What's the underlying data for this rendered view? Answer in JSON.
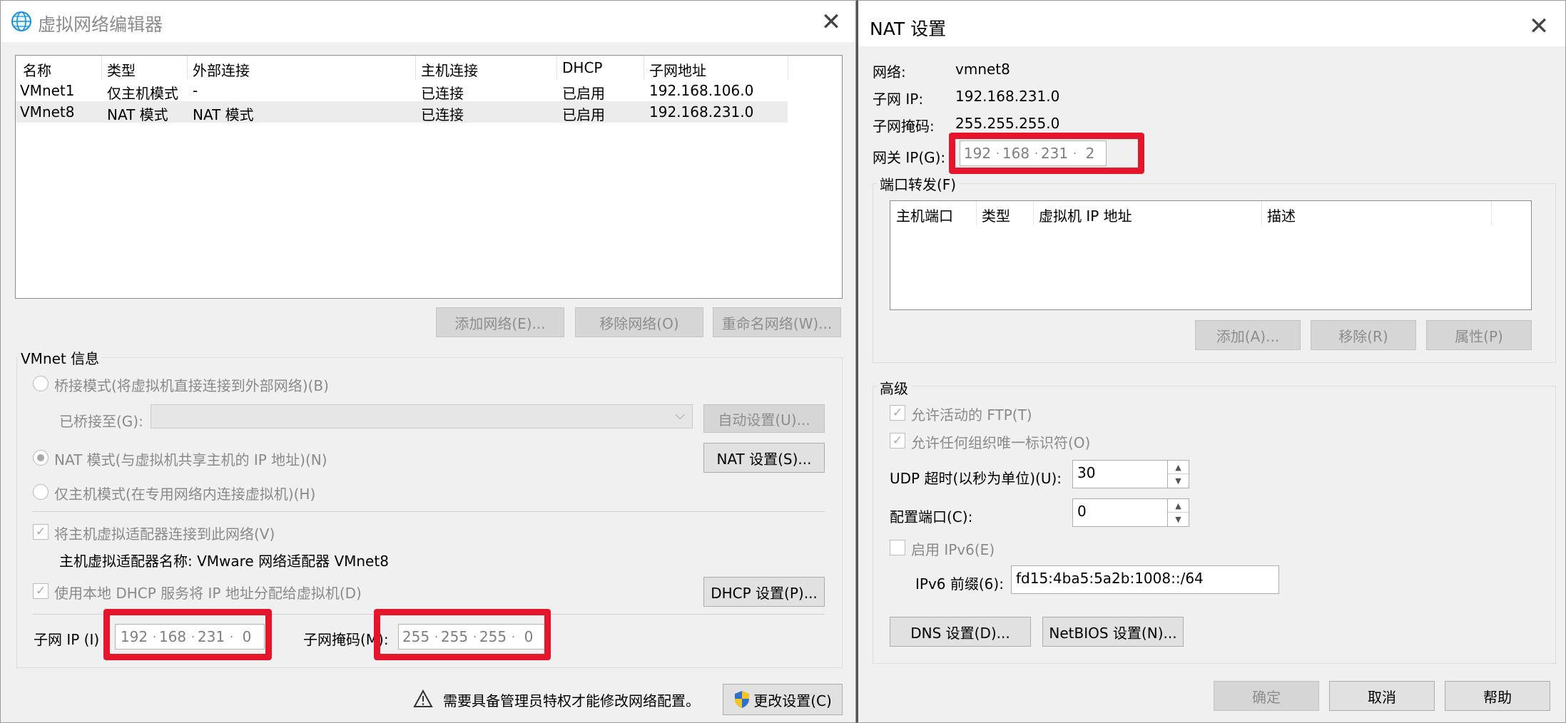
{
  "left_window": {
    "title": "虚拟网络编辑器",
    "icon": "globe-icon",
    "close": "✕",
    "columns": [
      "名称",
      "类型",
      "外部连接",
      "主机连接",
      "DHCP",
      "子网地址"
    ],
    "rows": [
      [
        "VMnet1",
        "仅主机模式",
        "-",
        "已连接",
        "已启用",
        "192.168.106.0"
      ],
      [
        "VMnet8",
        "NAT 模式",
        "NAT 模式",
        "已连接",
        "已启用",
        "192.168.231.0"
      ]
    ],
    "buttons": {
      "add": "添加网络(E)...",
      "remove": "移除网络(O)",
      "rename": "重命名网络(W)..."
    },
    "vmnet_info": {
      "label": "VMnet 信息",
      "bridged": "桥接模式(将虚拟机直接连接到外部网络)(B)",
      "bridged_to": "已桥接至(G):",
      "auto": "自动设置(U)...",
      "nat": "NAT 模式(与虚拟机共享主机的 IP 地址)(N)",
      "nat_settings": "NAT 设置(S)...",
      "hostonly": "仅主机模式(在专用网络内连接虚拟机)(H)",
      "connect_adapter": "将主机虚拟适配器连接到此网络(V)",
      "adapter_name": "主机虚拟适配器名称: VMware 网络适配器 VMnet8",
      "dhcp": "使用本地 DHCP 服务将 IP 地址分配给虚拟机(D)",
      "dhcp_settings": "DHCP 设置(P)...",
      "subnet_ip_label": "子网 IP (I)",
      "subnet_ip": [
        "192",
        "168",
        "231",
        "0"
      ],
      "subnet_mask_label": "子网掩码(M):",
      "subnet_mask": [
        "255",
        "255",
        "255",
        "0"
      ]
    },
    "admin_note": "需要具备管理员特权才能修改网络配置。",
    "change_settings": "更改设置(C)"
  },
  "right_window": {
    "title": "NAT 设置",
    "close": "✕",
    "network_label": "网络:",
    "network_value": "vmnet8",
    "subnet_ip_label": "子网 IP:",
    "subnet_ip_value": "192.168.231.0",
    "subnet_mask_label": "子网掩码:",
    "subnet_mask_value": "255.255.255.0",
    "gateway_label": "网关 IP(G):",
    "gateway": [
      "192",
      "168",
      "231",
      "2"
    ],
    "port_forwarding": {
      "label": "端口转发(F)",
      "columns": [
        "主机端口",
        "类型",
        "虚拟机 IP 地址",
        "描述"
      ],
      "add": "添加(A)...",
      "remove": "移除(R)",
      "properties": "属性(P)"
    },
    "advanced": {
      "label": "高级",
      "ftp": "允许活动的 FTP(T)",
      "oui": "允许任何组织唯一标识符(O)",
      "udp_label": "UDP 超时(以秒为单位)(U):",
      "udp_value": "30",
      "config_port_label": "配置端口(C):",
      "config_port_value": "0",
      "ipv6": "启用 IPv6(E)",
      "ipv6_prefix_label": "IPv6 前缀(6):",
      "ipv6_prefix_value": "fd15:4ba5:5a2b:1008::/64",
      "dns": "DNS 设置(D)...",
      "netbios": "NetBIOS 设置(N)..."
    },
    "ok": "确定",
    "cancel": "取消",
    "help": "帮助"
  },
  "colors": {
    "highlight": "#e5162b",
    "window_bg": "#f0f0f0",
    "accent": "#0078d7"
  }
}
